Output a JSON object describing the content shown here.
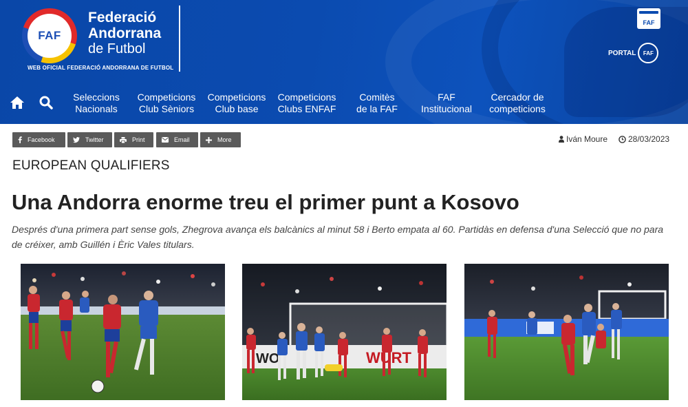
{
  "header": {
    "logo_text": "FAF",
    "brand_line1": "Federació",
    "brand_line2": "Andorrana",
    "brand_line3": "de Futbol",
    "brand_sub": "WEB OFICIAL FEDERACIÓ ANDORRANA DE FUTBOL",
    "faf_button": "FAF",
    "portal_label": "PORTAL",
    "portal_badge": "FAF",
    "accent_color": "#0b4bb0"
  },
  "nav": {
    "icons": [
      "home-icon",
      "search-icon"
    ],
    "items": [
      {
        "line1": "Seleccions",
        "line2": "Nacionals"
      },
      {
        "line1": "Competicions",
        "line2": "Club Sèniors"
      },
      {
        "line1": "Competicions",
        "line2": "Club base"
      },
      {
        "line1": "Competicions",
        "line2": "Clubs ENFAF"
      },
      {
        "line1": "Comitès",
        "line2": "de la FAF"
      },
      {
        "line1": "FAF",
        "line2": "Institucional"
      },
      {
        "line1": "Cercador de",
        "line2": "competicions"
      }
    ]
  },
  "share": {
    "facebook": "Facebook",
    "twitter": "Twitter",
    "print": "Print",
    "email": "Email",
    "more": "More"
  },
  "article": {
    "author": "Iván Moure",
    "date": "28/03/2023",
    "section": "EUROPEAN QUALIFIERS",
    "title": "Una Andorra enorme treu el primer punt a Kosovo",
    "lede": "Després d'una primera part sense gols, Zhegrova avança els balcànics al minut 58 i Berto empata al 60. Partidàs en defensa d'una Selecció que no para de créixer, amb Guillén i Èric Vales titulars.",
    "photo2_board": "WÜRT",
    "photo2_board2": "WO"
  }
}
